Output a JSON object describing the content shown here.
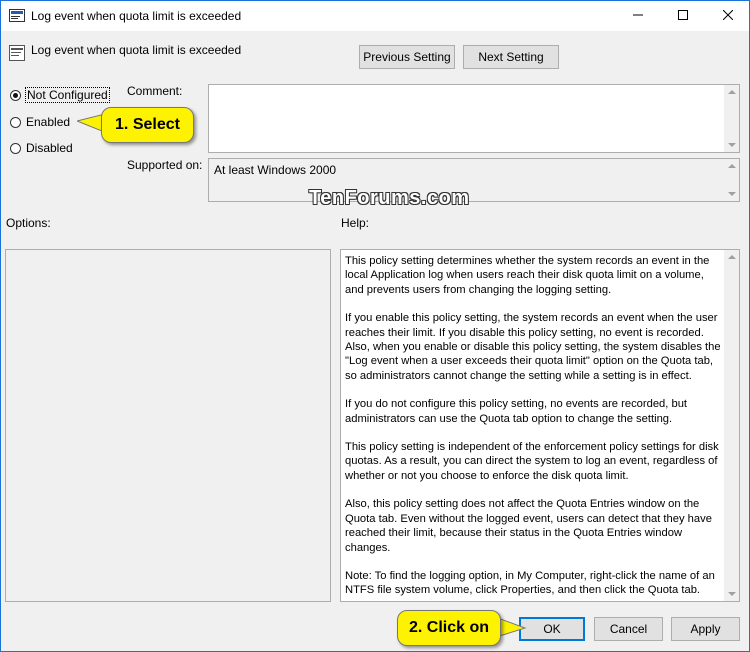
{
  "window": {
    "title": "Log event when quota limit is exceeded"
  },
  "header": {
    "title": "Log event when quota limit is exceeded",
    "prev_label": "Previous Setting",
    "next_label": "Next Setting"
  },
  "state": {
    "options": [
      {
        "label": "Not Configured",
        "selected": true
      },
      {
        "label": "Enabled",
        "selected": false
      },
      {
        "label": "Disabled",
        "selected": false
      }
    ]
  },
  "labels": {
    "comment": "Comment:",
    "supported_on": "Supported on:",
    "options": "Options:",
    "help": "Help:"
  },
  "supported_on_value": "At least Windows 2000",
  "help_paragraphs": [
    "This policy setting determines whether the system records an event in the local Application log when users reach their disk quota limit on a volume, and prevents users from changing the logging setting.",
    "If you enable this policy setting, the system records an event when the user reaches their limit. If you disable this policy setting, no event is recorded. Also, when you enable or disable this policy setting, the system disables the \"Log event when a user exceeds their quota limit\" option on the Quota tab, so administrators cannot change the setting while a setting is in effect.",
    "If you do not configure this policy setting, no events are recorded, but administrators can use the Quota tab option to change the setting.",
    "This policy setting is independent of the enforcement policy settings for disk quotas. As a result, you can direct the system to log an event, regardless of whether or not you choose to enforce the disk quota limit.",
    "Also, this policy setting does not affect the Quota Entries window on the Quota tab. Even without the logged event, users can detect that they have reached their limit, because their status in the Quota Entries window changes.",
    "Note: To find the logging option, in My Computer, right-click the name of an NTFS file system volume, click Properties, and then click the Quota tab."
  ],
  "footer": {
    "ok_label": "OK",
    "cancel_label": "Cancel",
    "apply_label": "Apply"
  },
  "annotations": {
    "select_callout": "1. Select",
    "click_callout": "2. Click on",
    "watermark": "TenForums.com",
    "callout_color": "#fdf200"
  },
  "icons": [
    "policy-icon",
    "minimize-icon",
    "maximize-icon",
    "close-icon"
  ]
}
